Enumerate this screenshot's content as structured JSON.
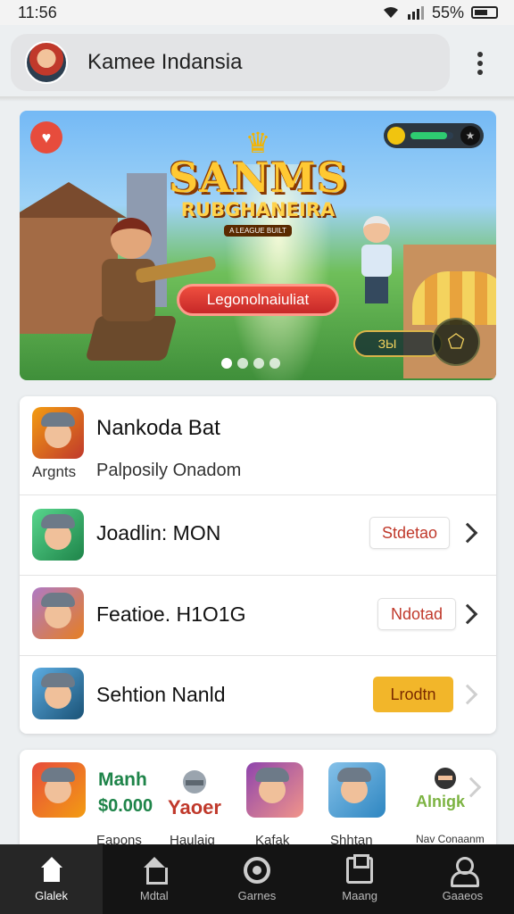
{
  "status_bar": {
    "time": "11:56",
    "battery": "55%",
    "wifi_icon": "wifi-icon",
    "signal_icon": "signal-icon",
    "battery_icon": "battery-icon"
  },
  "app_bar": {
    "title": "Kamee Indansia",
    "menu_icon": "more-vert-icon"
  },
  "banner": {
    "logo_title": "SANMS",
    "logo_subtitle": "RUBGHANEIRA",
    "logo_tag": "A LEAGUE BUILT",
    "cta_label": "Legonolnaiuliat",
    "chip_label": "ЗЫ",
    "xp_progress": 0.85,
    "carousel_pages": 4,
    "carousel_active": 0
  },
  "featured": {
    "title": "Nankoda Bat",
    "sub_left": "Argnts",
    "sub_right": "Palposily Onadom"
  },
  "list_rows": [
    {
      "label": "Joadlin: MON",
      "status": "Stdetao",
      "style": "outline"
    },
    {
      "label": "Featioe. H1O1G",
      "status": "Ndotad",
      "style": "outline"
    },
    {
      "label": "Sehtion Nanld",
      "status": "Lrodtn",
      "style": "gold"
    }
  ],
  "games": {
    "promo": {
      "line1": "Manh",
      "line2": "$0.000"
    },
    "brand": "Yaoer",
    "brand2": "Alnigk",
    "captions": [
      "Eapons",
      "Haulaig",
      "Kafak",
      "Shhtan",
      "Nav Conaanm"
    ]
  },
  "bottom_nav": [
    {
      "label": "Glalek",
      "icon": "home-icon",
      "active": true
    },
    {
      "label": "Mdtal",
      "icon": "house-icon",
      "active": false
    },
    {
      "label": "Garnes",
      "icon": "games-icon",
      "active": false
    },
    {
      "label": "Maang",
      "icon": "messages-icon",
      "active": false
    },
    {
      "label": "Gaaeos",
      "icon": "profile-icon",
      "active": false
    }
  ],
  "colors": {
    "accent_red": "#c62828",
    "gold": "#f2b62a",
    "nav_bg": "#141414"
  }
}
